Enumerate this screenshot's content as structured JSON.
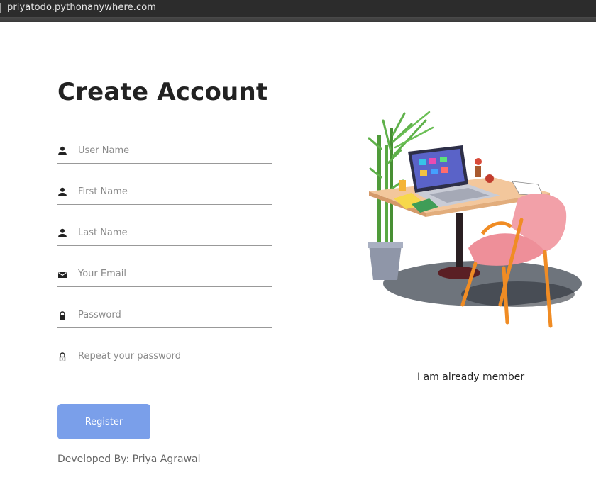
{
  "browser": {
    "url": "priyatodo.pythonanywhere.com"
  },
  "form": {
    "title": "Create Account",
    "fields": [
      {
        "name": "username",
        "placeholder": "User Name",
        "value": "",
        "icon": "person-icon"
      },
      {
        "name": "first_name",
        "placeholder": "First Name",
        "value": "",
        "icon": "person-icon"
      },
      {
        "name": "last_name",
        "placeholder": "Last Name",
        "value": "",
        "icon": "person-icon"
      },
      {
        "name": "email",
        "placeholder": "Your Email",
        "value": "",
        "icon": "envelope-icon"
      },
      {
        "name": "password",
        "placeholder": "Password",
        "value": "",
        "icon": "lock-icon"
      },
      {
        "name": "repeat_password",
        "placeholder": "Repeat your password",
        "value": "",
        "icon": "lock-outline-icon"
      }
    ],
    "register_label": "Register"
  },
  "footer": {
    "credit": "Developed By: Priya Agrawal"
  },
  "side": {
    "illustration": "desk-laptop-illustration",
    "member_link": "I am already member"
  },
  "colors": {
    "accent": "#7a9fea",
    "title": "#222222",
    "underline": "#999999",
    "placeholder": "#8a8a8a",
    "url_bar": "#2c2c2c"
  }
}
